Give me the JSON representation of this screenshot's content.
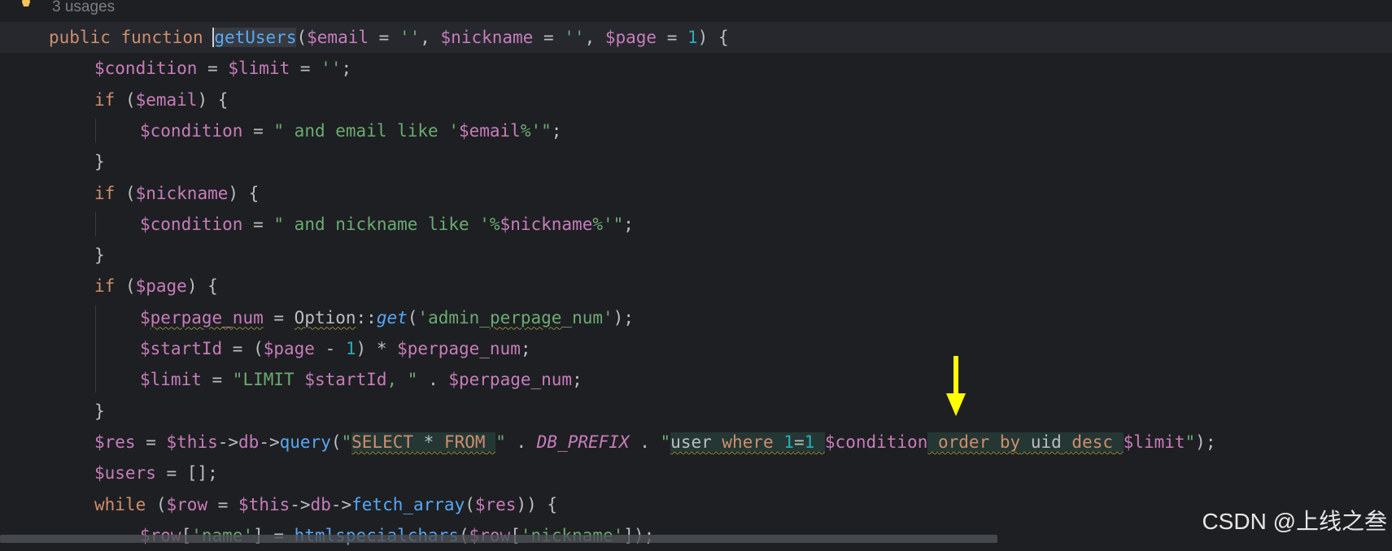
{
  "editor": {
    "usages_hint": "3 usages",
    "lines": [
      "public function getUsers($email = '', $nickname = '', $page = 1) {",
      "$condition = $limit = '';",
      "if ($email) {",
      "$condition = \" and email like '$email%'\";",
      "}",
      "if ($nickname) {",
      "$condition = \" and nickname like '%$nickname%'\";",
      "}",
      "if ($page) {",
      "$perpage_num = Option::get('admin_perpage_num');",
      "$startId = ($page - 1) * $perpage_num;",
      "$limit = \"LIMIT $startId, \" . $perpage_num;",
      "}",
      "$res = $this->db->query(\"SELECT * FROM \" . DB_PREFIX . \"user where 1=1 $condition order by uid desc $limit\");",
      "$users = [];",
      "while ($row = $this->db->fetch_array($res)) {",
      "$row['name'] = htmlspecialchars($row['nickname']);"
    ]
  },
  "annotation": {
    "arrow_color": "#ffff00",
    "arrow_icon": "arrow-down-icon"
  },
  "watermark": "CSDN @上线之叁",
  "colors": {
    "background": "#1e1f22",
    "keyword": "#cf8e6d",
    "variable": "#c77dbb",
    "string": "#6aab73",
    "number": "#2aacb8",
    "function": "#56a8f5"
  }
}
